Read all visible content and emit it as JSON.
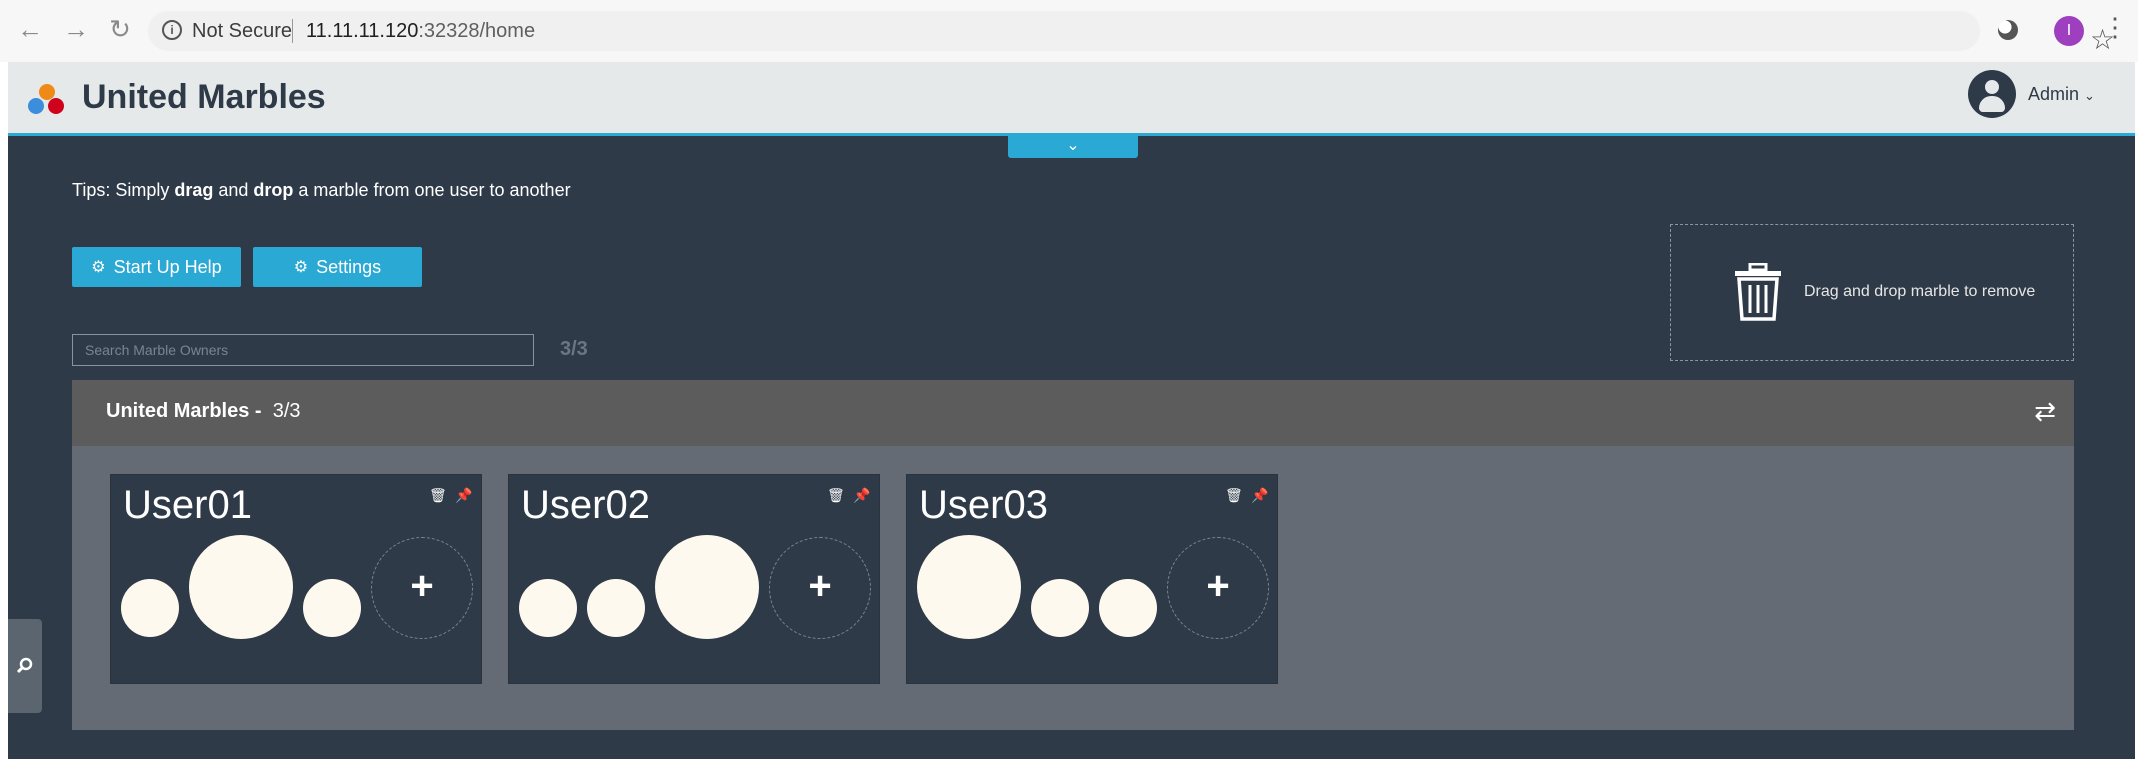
{
  "browser": {
    "security_label": "Not Secure",
    "url_host": "11.11.11.120",
    "url_rest": ":32328/home",
    "profile_initial": "I"
  },
  "app": {
    "title": "United Marbles",
    "user_label": "Admin",
    "logo_colors": [
      "#ef8a17",
      "#3c8ddb",
      "#d0021b"
    ],
    "accent_color": "#2aa9d4"
  },
  "tips": {
    "prefix": "Tips: Simply ",
    "bold1": "drag",
    "middle": " and ",
    "bold2": "drop",
    "suffix": " a marble from one user to another"
  },
  "buttons": {
    "startup_help": "Start Up Help",
    "settings": "Settings"
  },
  "search": {
    "placeholder": "Search Marble Owners",
    "count": "3/3"
  },
  "trash": {
    "text": "Drag and drop marble to remove"
  },
  "panel": {
    "title": "United Marbles -",
    "count": "3/3"
  },
  "owners": [
    {
      "name": "User01",
      "marbles": [
        "small",
        "large",
        "small"
      ]
    },
    {
      "name": "User02",
      "marbles": [
        "small",
        "small",
        "large"
      ]
    },
    {
      "name": "User03",
      "marbles": [
        "large",
        "small",
        "small"
      ]
    }
  ],
  "add_label": "+"
}
